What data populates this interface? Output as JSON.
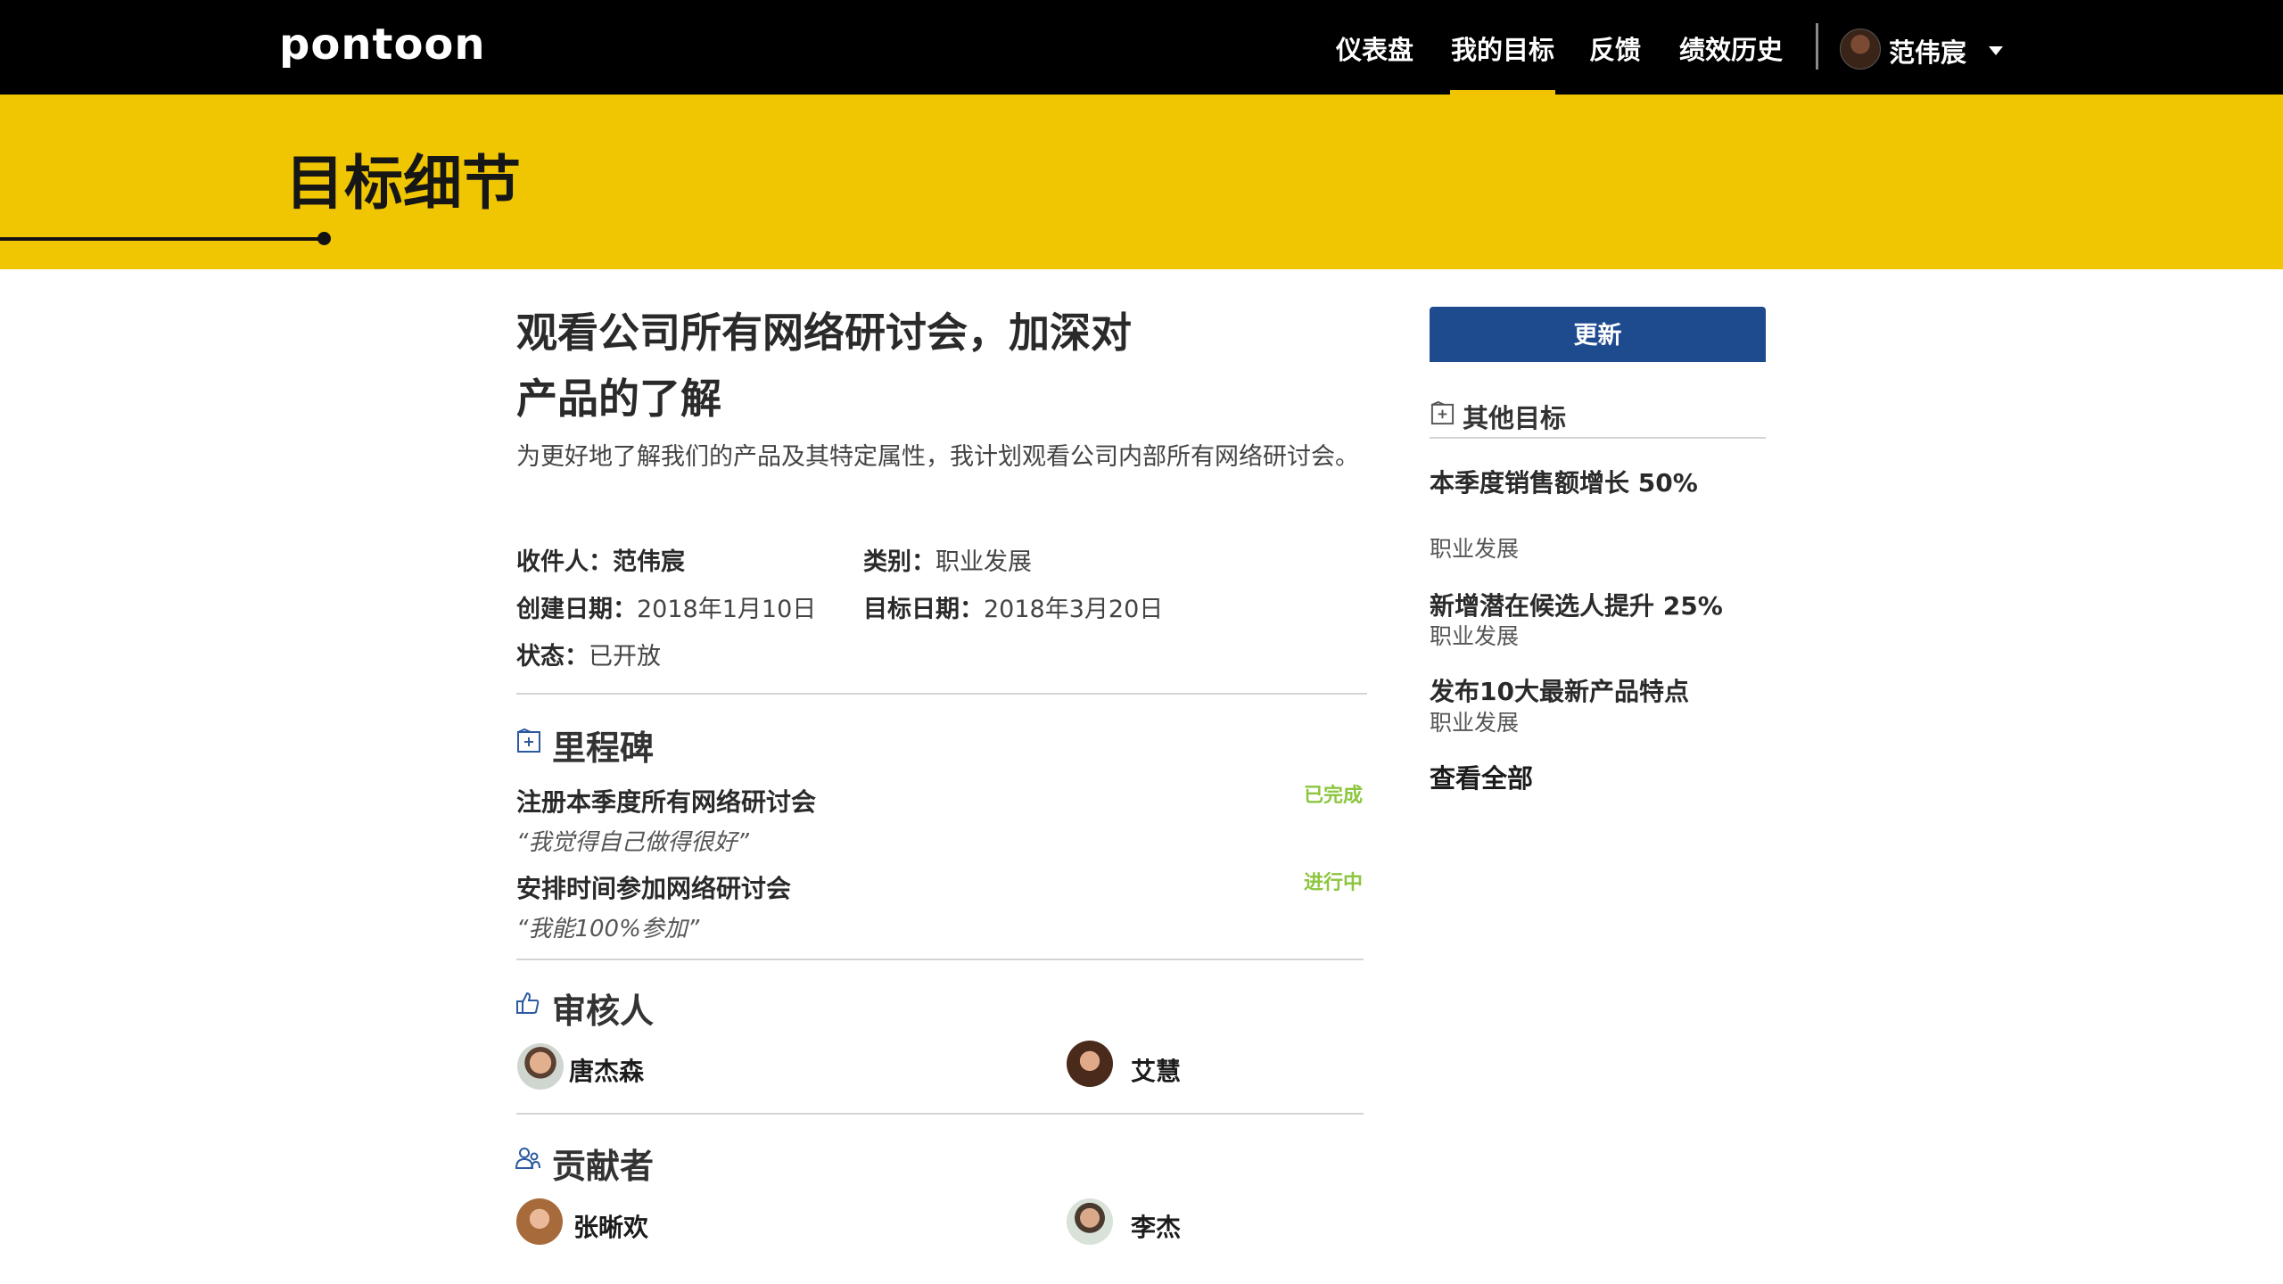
{
  "brand": {
    "logo_text": "pontoon"
  },
  "nav": {
    "items": [
      {
        "label": "仪表盘",
        "active": false
      },
      {
        "label": "我的目标",
        "active": true
      },
      {
        "label": "反馈",
        "active": false
      },
      {
        "label": "绩效历史",
        "active": false
      }
    ],
    "user_name": "范伟宸",
    "accent_color": "#f2c400"
  },
  "banner": {
    "title": "目标细节",
    "background": "#f0c502"
  },
  "goal": {
    "title": "观看公司所有网络研讨会，加深对产品的了解",
    "description": "为更好地了解我们的产品及其特定属性，我计划观看公司内部所有网络研讨会。",
    "meta": {
      "assignee_label": "收件人：",
      "assignee_value": "范伟宸",
      "category_label": "类别：",
      "category_value": "职业发展",
      "created_label": "创建日期：",
      "created_value": "2018年1月10日",
      "target_label": "目标日期：",
      "target_value": "2018年3月20日",
      "status_label": "状态：",
      "status_value": "已开放"
    }
  },
  "milestones": {
    "heading": "里程碑",
    "icon": "plus-square-icon",
    "items": [
      {
        "title": "注册本季度所有网络研讨会",
        "note": "“我觉得自己做得很好”",
        "status": "已完成"
      },
      {
        "title": "安排时间参加网络研讨会",
        "note": "“我能100%参加”",
        "status": "进行中"
      }
    ],
    "status_color": "#8cc63f"
  },
  "reviewers": {
    "heading": "审核人",
    "icon": "thumbs-up-icon",
    "people": [
      {
        "name": "唐杰森"
      },
      {
        "name": "艾慧"
      }
    ]
  },
  "contributors": {
    "heading": "贡献者",
    "icon": "people-icon",
    "people": [
      {
        "name": "张晰欢"
      },
      {
        "name": "李杰"
      }
    ]
  },
  "sidebar": {
    "update_label": "更新",
    "update_color": "#1e4a8e",
    "other_goals_heading": "其他目标",
    "goals": [
      {
        "title": "本季度销售额增长 50%",
        "category": "职业发展"
      },
      {
        "title": "新增潜在候选人提升 25%",
        "category": "职业发展"
      },
      {
        "title": "发布10大最新产品特点",
        "category": "职业发展"
      }
    ],
    "view_all_label": "查看全部"
  }
}
